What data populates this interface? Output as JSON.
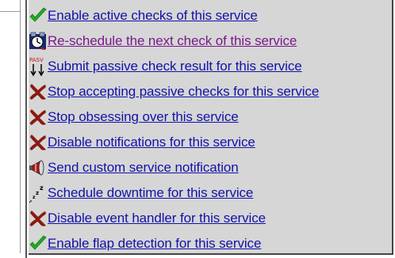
{
  "commands": [
    {
      "label": "Enable active checks of this service",
      "icon": "check-icon",
      "visited": false
    },
    {
      "label": "Re-schedule the next check of this service",
      "icon": "clock-icon",
      "visited": true
    },
    {
      "label": "Submit passive check result for this service",
      "icon": "pasv-icon",
      "visited": false
    },
    {
      "label": "Stop accepting passive checks for this service",
      "icon": "x-icon",
      "visited": false
    },
    {
      "label": "Stop obsessing over this service",
      "icon": "x-icon",
      "visited": false
    },
    {
      "label": "Disable notifications for this service",
      "icon": "x-icon",
      "visited": false
    },
    {
      "label": "Send custom service notification",
      "icon": "megaphone-icon",
      "visited": false
    },
    {
      "label": "Schedule downtime for this service",
      "icon": "sleep-icon",
      "visited": false
    },
    {
      "label": "Disable event handler for this service",
      "icon": "x-icon",
      "visited": false
    },
    {
      "label": "Enable flap detection for this service",
      "icon": "check-icon",
      "visited": false
    }
  ],
  "pasv_icon_text": "PASV",
  "colors": {
    "panel_bg": "#d6d6d6",
    "link": "#1111aa",
    "visited_link": "#7a1a8a",
    "check_green": "#22aa22",
    "x_red": "#8b1a10"
  }
}
